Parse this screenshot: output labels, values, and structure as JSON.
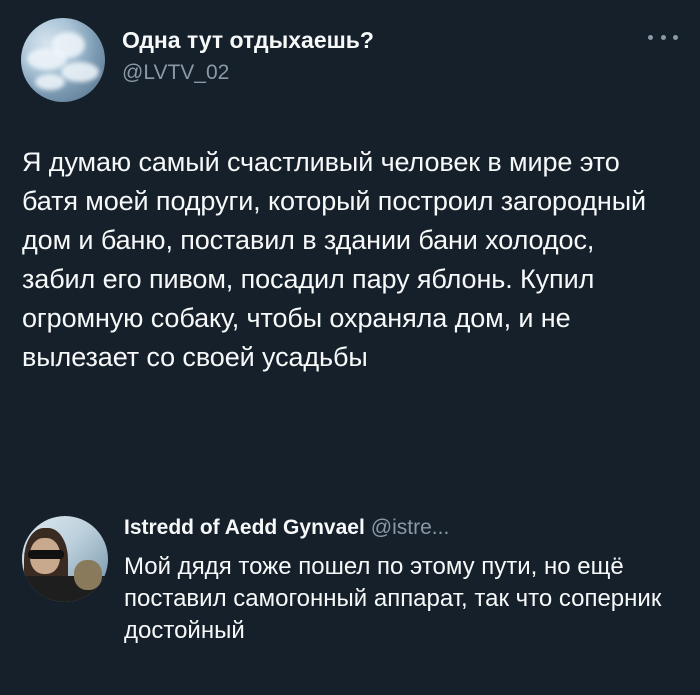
{
  "tweet": {
    "author_name": "Одна тут отдыхаешь?",
    "author_handle": "@LVTV_02",
    "more_icon": "more-horizontal-icon",
    "text": "Я думаю самый счастливый человек в мире это батя моей подруги, который построил загородный дом и баню, поставил в здании бани холодос, забил его пивом, посадил пару яблонь. Купил огромную собаку, чтобы охраняла дом, и не вылезает со своей усадьбы"
  },
  "reply": {
    "author_name": "Istredd of Aedd Gynvael",
    "author_handle": "@istre...",
    "text": "Мой дядя тоже пошел по этому пути, но ещё поставил самогонный аппарат, так что соперник достойный"
  },
  "colors": {
    "background": "#15202b",
    "text_primary": "#f7f9f9",
    "text_secondary": "#8b98a5"
  }
}
